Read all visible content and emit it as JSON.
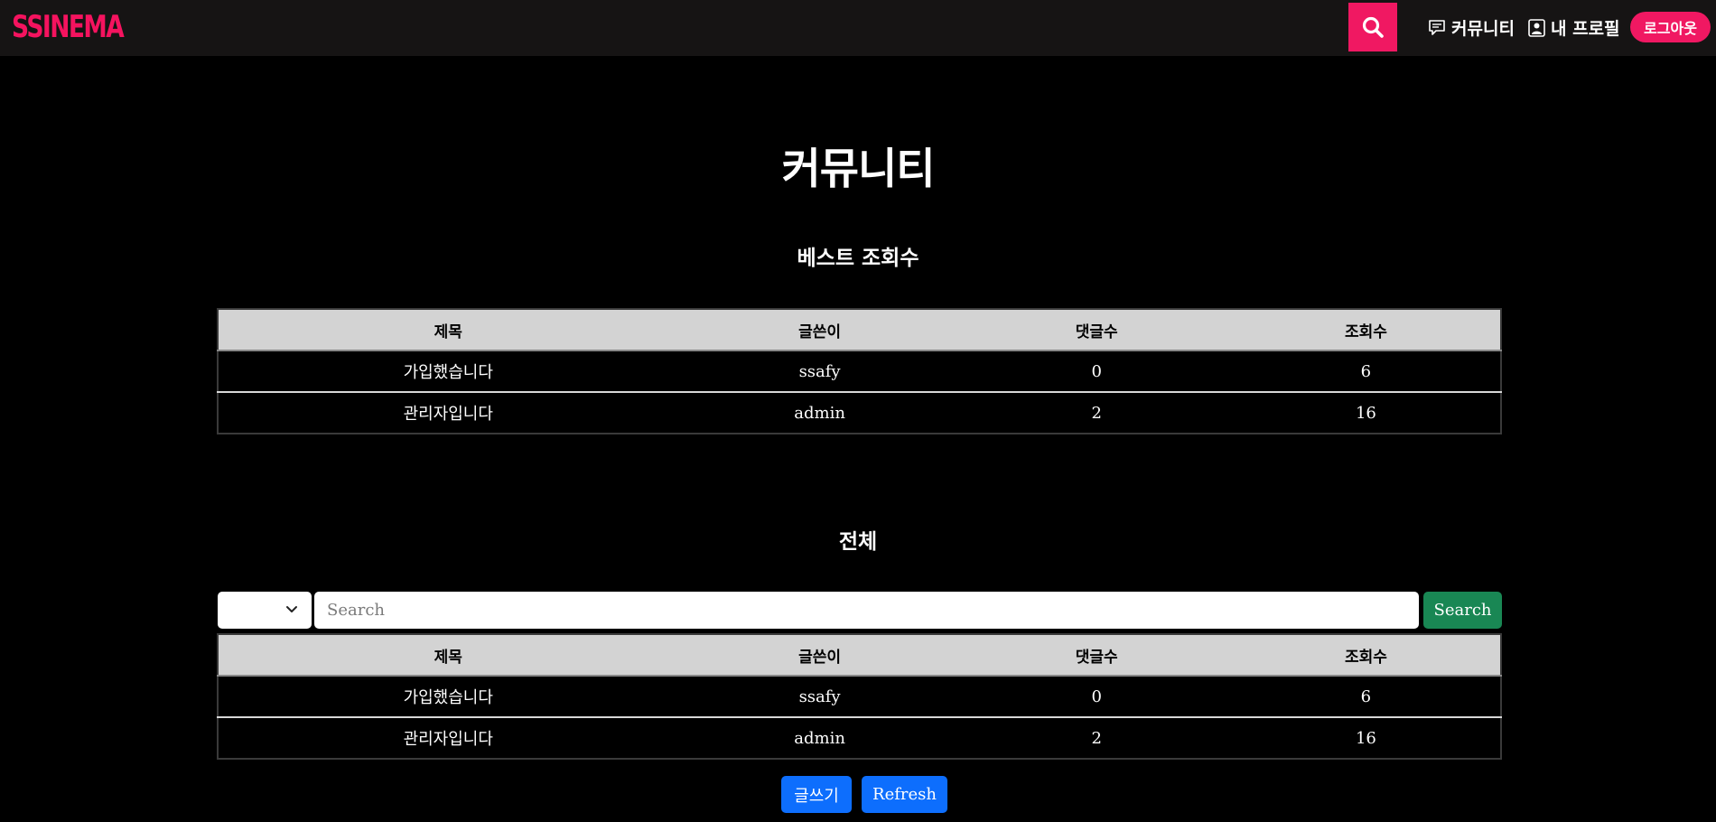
{
  "brand": {
    "logo": "SSINEMA",
    "accent_color": "#f01862"
  },
  "nav": {
    "search_icon": "search-icon",
    "community_label": "커뮤니티",
    "profile_label": "내 프로필",
    "logout_label": "로그아웃"
  },
  "page": {
    "title": "커뮤니티"
  },
  "best": {
    "title": "베스트 조회수",
    "columns": [
      "제목",
      "글쓴이",
      "댓글수",
      "조회수"
    ],
    "rows": [
      [
        "가입했습니다",
        "ssafy",
        "0",
        "6"
      ],
      [
        "관리자입니다",
        "admin",
        "2",
        "16"
      ]
    ]
  },
  "all": {
    "title": "전체",
    "filter_value": "",
    "search_placeholder": "Search",
    "search_button": "Search",
    "columns": [
      "제목",
      "글쓴이",
      "댓글수",
      "조회수"
    ],
    "rows": [
      [
        "가입했습니다",
        "ssafy",
        "0",
        "6"
      ],
      [
        "관리자입니다",
        "admin",
        "2",
        "16"
      ]
    ]
  },
  "actions": {
    "write_label": "글쓰기",
    "refresh_label": "Refresh"
  }
}
